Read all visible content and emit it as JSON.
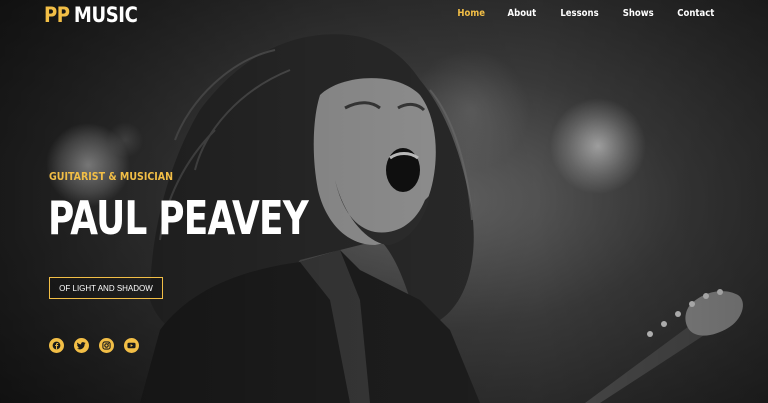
{
  "brand": {
    "logo_pp": "PP",
    "logo_music": "MUSIC",
    "accent_color": "#f2be46"
  },
  "nav": {
    "items": [
      {
        "label": "Home",
        "active": true
      },
      {
        "label": "About",
        "active": false
      },
      {
        "label": "Lessons",
        "active": false
      },
      {
        "label": "Shows",
        "active": false
      },
      {
        "label": "Contact",
        "active": false
      }
    ]
  },
  "hero": {
    "tagline": "GUITARIST & MUSICIAN",
    "title": "PAUL PEAVEY",
    "cta_label": "OF LIGHT AND SHADOW",
    "background": "black-and-white photo of a long-haired bearded guitarist screaming on stage"
  },
  "social": {
    "icons": [
      "facebook-icon",
      "twitter-icon",
      "instagram-icon",
      "youtube-icon"
    ]
  }
}
